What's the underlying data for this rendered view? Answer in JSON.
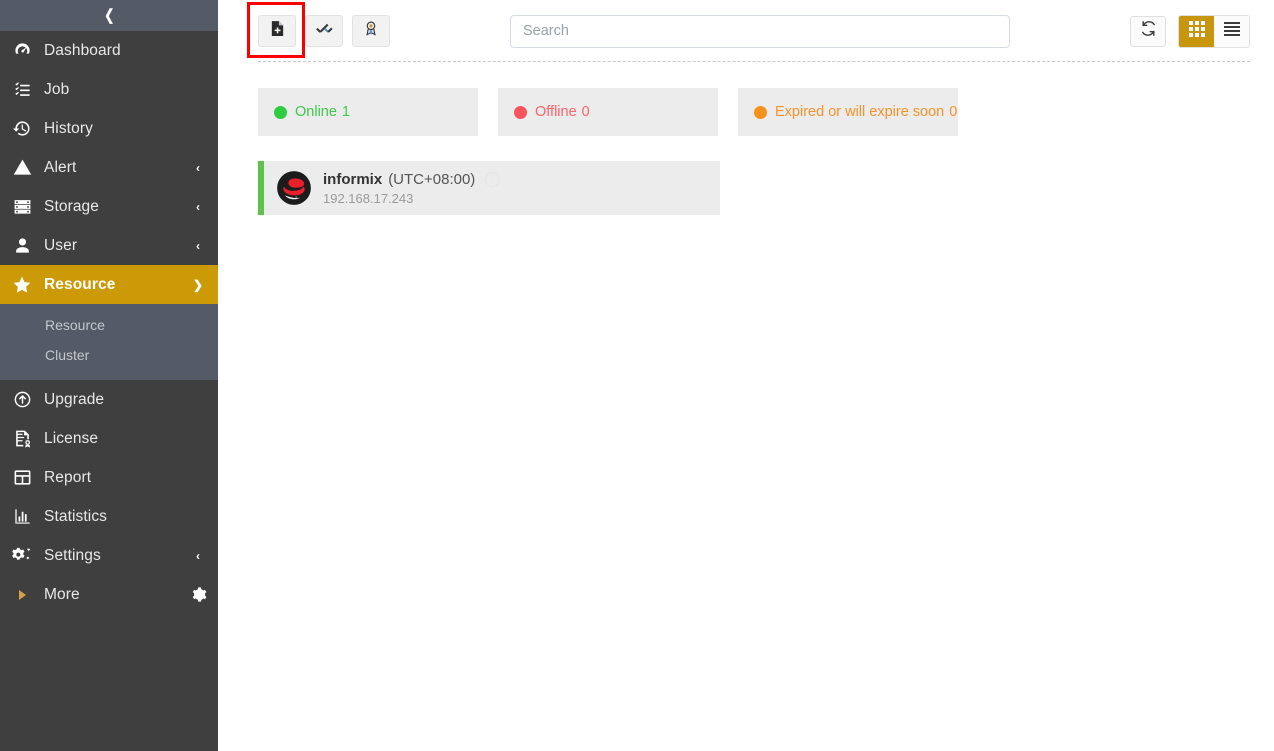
{
  "sidebar": {
    "collapse_icon": "chevron-left-icon",
    "items": [
      {
        "label": "Dashboard",
        "icon": "dashboard-gauge-icon",
        "arrow": null,
        "active": false
      },
      {
        "label": "Job",
        "icon": "job-list-icon",
        "arrow": null,
        "active": false
      },
      {
        "label": "History",
        "icon": "history-clock-icon",
        "arrow": null,
        "active": false
      },
      {
        "label": "Alert",
        "icon": "alert-warning-triangle-icon",
        "arrow": "‹",
        "active": false
      },
      {
        "label": "Storage",
        "icon": "storage-server-icon",
        "arrow": "‹",
        "active": false
      },
      {
        "label": "User",
        "icon": "user-person-icon",
        "arrow": "‹",
        "active": false
      },
      {
        "label": "Resource",
        "icon": "star-icon",
        "arrow": "⌄",
        "active": true
      },
      {
        "label": "Upgrade",
        "icon": "upgrade-arrow-up-circle-icon",
        "arrow": null,
        "active": false
      },
      {
        "label": "License",
        "icon": "license-certificate-icon",
        "arrow": null,
        "active": false
      },
      {
        "label": "Report",
        "icon": "report-table-icon",
        "arrow": null,
        "active": false
      },
      {
        "label": "Statistics",
        "icon": "statistics-bar-chart-icon",
        "arrow": null,
        "active": false
      },
      {
        "label": "Settings",
        "icon": "settings-gears-icon",
        "arrow": "‹",
        "active": false
      },
      {
        "label": "More",
        "icon": "triangle-right-icon",
        "arrow": null,
        "active": false,
        "right_icon": "gear-icon"
      }
    ],
    "submenu": [
      {
        "label": "Resource"
      },
      {
        "label": "Cluster"
      }
    ]
  },
  "toolbar": {
    "buttons": [
      {
        "name": "add-resource-button",
        "icon": "file-add-icon",
        "highlighted": true
      },
      {
        "name": "batch-select-button",
        "icon": "double-check-icon",
        "highlighted": false
      },
      {
        "name": "license-badge-button",
        "icon": "award-ribbon-icon",
        "highlighted": false
      }
    ],
    "search": {
      "placeholder": "Search",
      "value": ""
    },
    "refresh": {
      "name": "refresh-button",
      "icon": "refresh-icon"
    },
    "views": [
      {
        "name": "grid-view-button",
        "icon": "grid-icon",
        "active": true
      },
      {
        "name": "list-view-button",
        "icon": "list-icon",
        "active": false
      }
    ]
  },
  "status_cards": [
    {
      "label": "Online",
      "count": "1",
      "color": "#2ecc40",
      "text_color": "#3ec94a"
    },
    {
      "label": "Offline",
      "count": "0",
      "color": "#f9545b",
      "text_color": "#f9656b"
    },
    {
      "label": "Expired or will expire soon",
      "count": "0",
      "color": "#f5921e",
      "text_color": "#f5922a"
    }
  ],
  "resources": [
    {
      "name": "informix",
      "timezone": "(UTC+08:00)",
      "ip": "192.168.17.243",
      "os_logo": "redhat-logo-icon",
      "status_color": "#5cc24a",
      "info_icon": "info-circle-icon"
    }
  ],
  "colors": {
    "sidebar_bg": "#3f3f3f",
    "sidebar_header_bg": "#555b66",
    "active_item_bg": "#cc9a06",
    "submenu_bg": "#555b66",
    "card_bg": "#ececec",
    "highlight_border": "#ff0000",
    "view_active_bg": "#c8960c"
  }
}
